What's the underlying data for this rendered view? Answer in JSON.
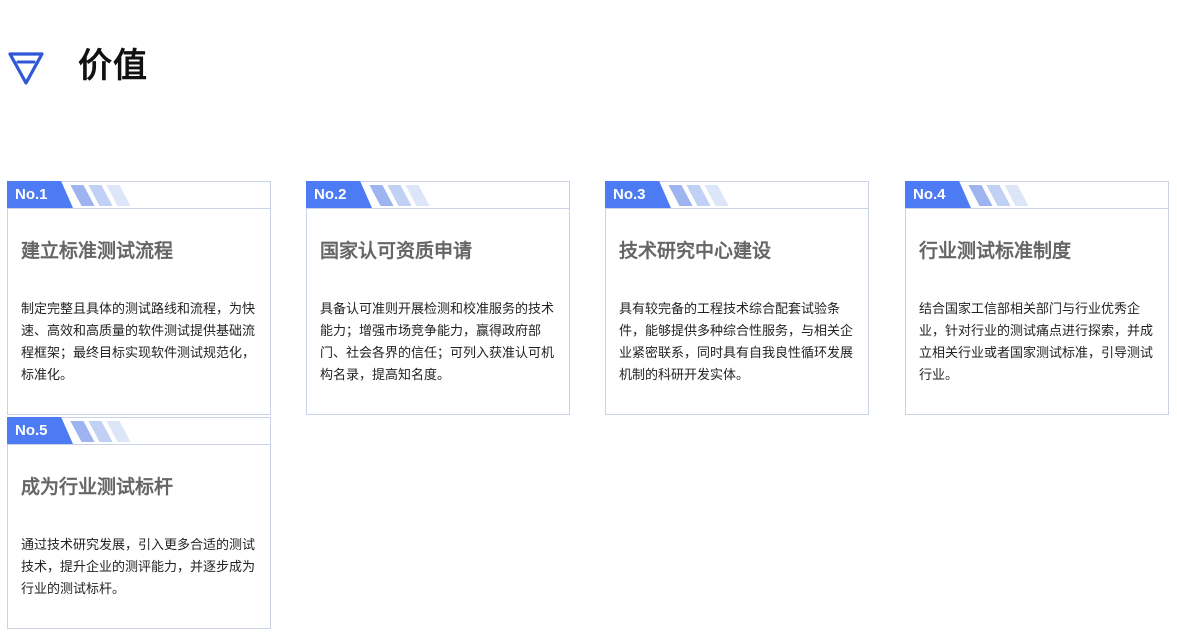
{
  "section": {
    "title": "价值",
    "icon": "diamond-icon",
    "accent_color": "#4d7bf3"
  },
  "cards": [
    {
      "tag": "No.1",
      "title": "建立标准测试流程",
      "description": "制定完整且具体的测试路线和流程，为快速、高效和高质量的软件测试提供基础流程框架；最终目标实现软件测试规范化，标准化。"
    },
    {
      "tag": "No.2",
      "title": "国家认可资质申请",
      "description": "具备认可准则开展检测和校准服务的技术能力；增强市场竞争能力，赢得政府部门、社会各界的信任；可列入获准认可机构名录，提高知名度。"
    },
    {
      "tag": "No.3",
      "title": "技术研究中心建设",
      "description": "具有较完备的工程技术综合配套试验条件，能够提供多种综合性服务，与相关企业紧密联系，同时具有自我良性循环发展机制的科研开发实体。"
    },
    {
      "tag": "No.4",
      "title": "行业测试标准制度",
      "description": "结合国家工信部相关部门与行业优秀企业，针对行业的测试痛点进行探索，并成立相关行业或者国家测试标准，引导测试行业。"
    },
    {
      "tag": "No.5",
      "title": "成为行业测试标杆",
      "description": "通过技术研究发展，引入更多合适的测试技术，提升企业的测评能力，并逐步成为行业的测试标杆。"
    }
  ]
}
